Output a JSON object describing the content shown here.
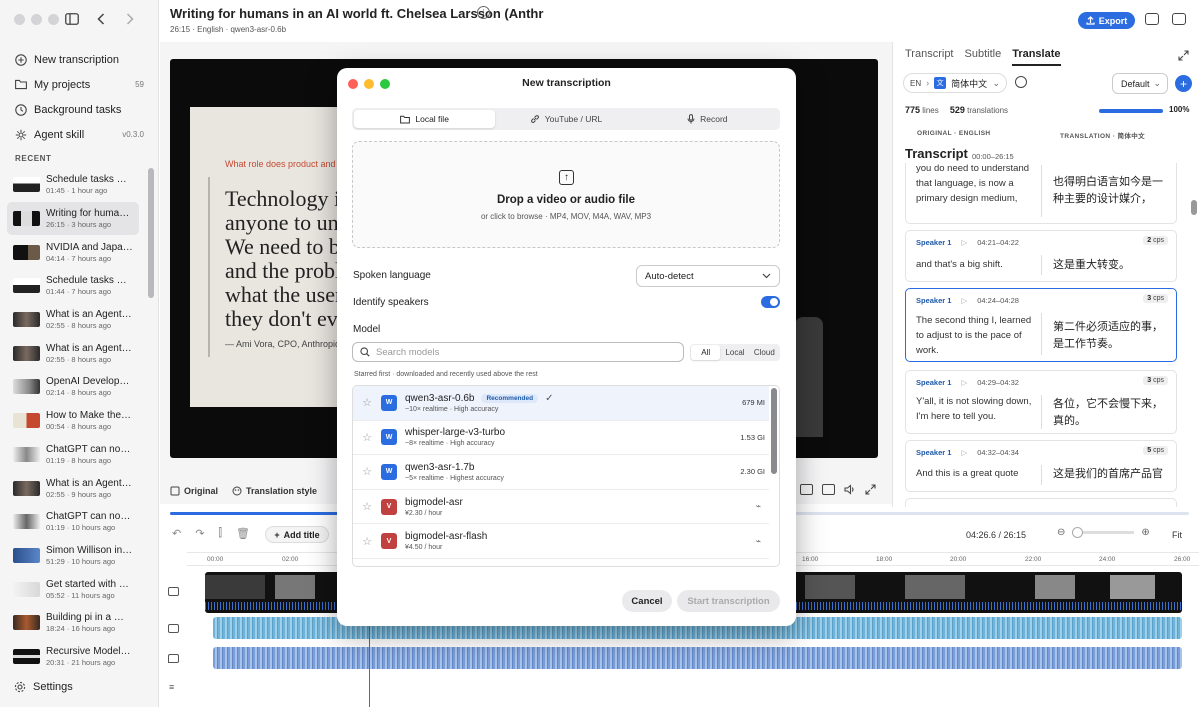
{
  "sidebar": {
    "nav": [
      {
        "label": "New transcription",
        "icon": "plus-circle-icon"
      },
      {
        "label": "My projects",
        "icon": "folder-icon",
        "count": "59"
      },
      {
        "label": "Background tasks",
        "icon": "clock-icon"
      },
      {
        "label": "Agent skill",
        "icon": "agent-icon",
        "count": "v0.3.0"
      }
    ],
    "recent_label": "RECENT",
    "recent": [
      {
        "title": "Schedule tasks wit…",
        "meta": "01:45 · 1 hour ago"
      },
      {
        "title": "Writing for human…",
        "meta": "26:15 · 3 hours ago"
      },
      {
        "title": "NVIDIA and Japan:…",
        "meta": "04:14 · 7 hours ago"
      },
      {
        "title": "Schedule tasks wit…",
        "meta": "01:44 · 7 hours ago"
      },
      {
        "title": "What is an Agentic…",
        "meta": "02:55 · 8 hours ago"
      },
      {
        "title": "What is an Agentic…",
        "meta": "02:55 · 8 hours ago"
      },
      {
        "title": "OpenAI Developers…",
        "meta": "02:14 · 8 hours ago"
      },
      {
        "title": "How to Make the M…",
        "meta": "00:54 · 8 hours ago"
      },
      {
        "title": "ChatGPT can now c…",
        "meta": "01:19 · 8 hours ago"
      },
      {
        "title": "What is an Agentic…",
        "meta": "02:55 · 9 hours ago"
      },
      {
        "title": "ChatGPT can now c…",
        "meta": "01:19 · 10 hours ago"
      },
      {
        "title": "Simon Willison in c…",
        "meta": "51:29 · 10 hours ago"
      },
      {
        "title": "Get started with Ch…",
        "meta": "05:52 · 11 hours ago"
      },
      {
        "title": "Building pi in a Wor…",
        "meta": "18:24 · 16 hours ago"
      },
      {
        "title": "Recursive Model I…",
        "meta": "20:31 · 21 hours ago"
      }
    ],
    "settings_label": "Settings"
  },
  "header": {
    "title": "Writing for humans in an AI world ft. Chelsea Larsson (Anthr",
    "subtitle": "26:15 · English · qwen3-asr-0.6b",
    "export_label": "Export"
  },
  "video": {
    "slide_question": "What role does product and",
    "slide_quote": "Technology i\nanyone to und\nWe need to be\nand the probl\nwhat the user\nthey don't eve",
    "slide_attribution": "— Ami Vora, CPO, Anthropic",
    "toolbar": {
      "original": "Original",
      "translation_style": "Translation style"
    }
  },
  "right_panel": {
    "tabs": [
      "Transcript",
      "Subtitle",
      "Translate"
    ],
    "active_tab": "Translate",
    "lang_from": "EN",
    "lang_to": "简体中文",
    "preset": "Default",
    "lines_count": "775",
    "lines_label": "lines",
    "translations_count": "529",
    "translations_label": "translations",
    "progress": 1.0,
    "progress_label": "100%",
    "col_original": "ORIGINAL · ENGLISH",
    "col_translation": "TRANSLATION · 简体中文",
    "transcript_title": "Transcript",
    "transcript_range": "00:00–26:15",
    "segments": [
      {
        "speaker": "",
        "time": "",
        "cps": "",
        "en": "you do need to understand that language, is now a primary design medium,",
        "zh": "也得明白语言如今是一种主要的设计媒介，"
      },
      {
        "speaker": "Speaker 1",
        "time": "04:21–04:22",
        "cps": "2",
        "en": "and that's a big shift.",
        "zh": "这是重大转变。"
      },
      {
        "speaker": "Speaker 1",
        "time": "04:24–04:28",
        "cps": "3",
        "en": "The second thing I, learned to adjust to is the pace of work.",
        "zh": "第二件必须适应的事，是工作节奏。"
      },
      {
        "speaker": "Speaker 1",
        "time": "04:29–04:32",
        "cps": "3",
        "en": "Y'all, it is not slowing down, I'm here to tell you.",
        "zh": "各位，它不会慢下来，真的。"
      },
      {
        "speaker": "Speaker 1",
        "time": "04:32–04:34",
        "cps": "5",
        "en": "And this is a great quote",
        "zh": "这是我们的首席产品官"
      }
    ],
    "cps_unit": "cps"
  },
  "timeline": {
    "add_title": "Add title",
    "time_readout": "04:26.6 / 26:15",
    "fit_label": "Fit",
    "ticks": [
      "00:00",
      "02:00",
      "16:00",
      "18:00",
      "20:00",
      "22:00",
      "24:00",
      "26:00"
    ],
    "playback_progress": 0.17
  },
  "modal": {
    "title": "New transcription",
    "sources": [
      "Local file",
      "YouTube / URL",
      "Record"
    ],
    "active_source": "Local file",
    "drop_title": "Drop a video or audio file",
    "drop_subtitle": "or click to browse · MP4, MOV, M4A, WAV, MP3",
    "spoken_language_label": "Spoken language",
    "spoken_language_value": "Auto-detect",
    "identify_speakers_label": "Identify speakers",
    "identify_speakers_on": true,
    "model_label": "Model",
    "search_placeholder": "Search models",
    "filters": [
      "All",
      "Local",
      "Cloud"
    ],
    "active_filter": "All",
    "list_hint": "Starred first · downloaded and recently used above the rest",
    "models": [
      {
        "badge": "W",
        "name": "qwen3-asr-0.6b",
        "desc": "~10× realtime · High accuracy",
        "size": "679 MI",
        "recommended": "Recommended",
        "selected": true,
        "badge_color": "#2b6de0"
      },
      {
        "badge": "W",
        "name": "whisper-large-v3-turbo",
        "desc": "~8× realtime · High accuracy",
        "size": "1.53 GI",
        "badge_color": "#2b6de0"
      },
      {
        "badge": "W",
        "name": "qwen3-asr-1.7b",
        "desc": "~5× realtime · Highest accuracy",
        "size": "2.30 GI",
        "badge_color": "#2b6de0"
      },
      {
        "badge": "V",
        "name": "bigmodel-asr",
        "desc": "¥2.30 / hour",
        "size": "",
        "badge_color": "#c0413f"
      },
      {
        "badge": "V",
        "name": "bigmodel-asr-flash",
        "desc": "¥4.50 / hour",
        "size": "",
        "badge_color": "#c0413f"
      }
    ],
    "cancel_label": "Cancel",
    "start_label": "Start transcription"
  }
}
